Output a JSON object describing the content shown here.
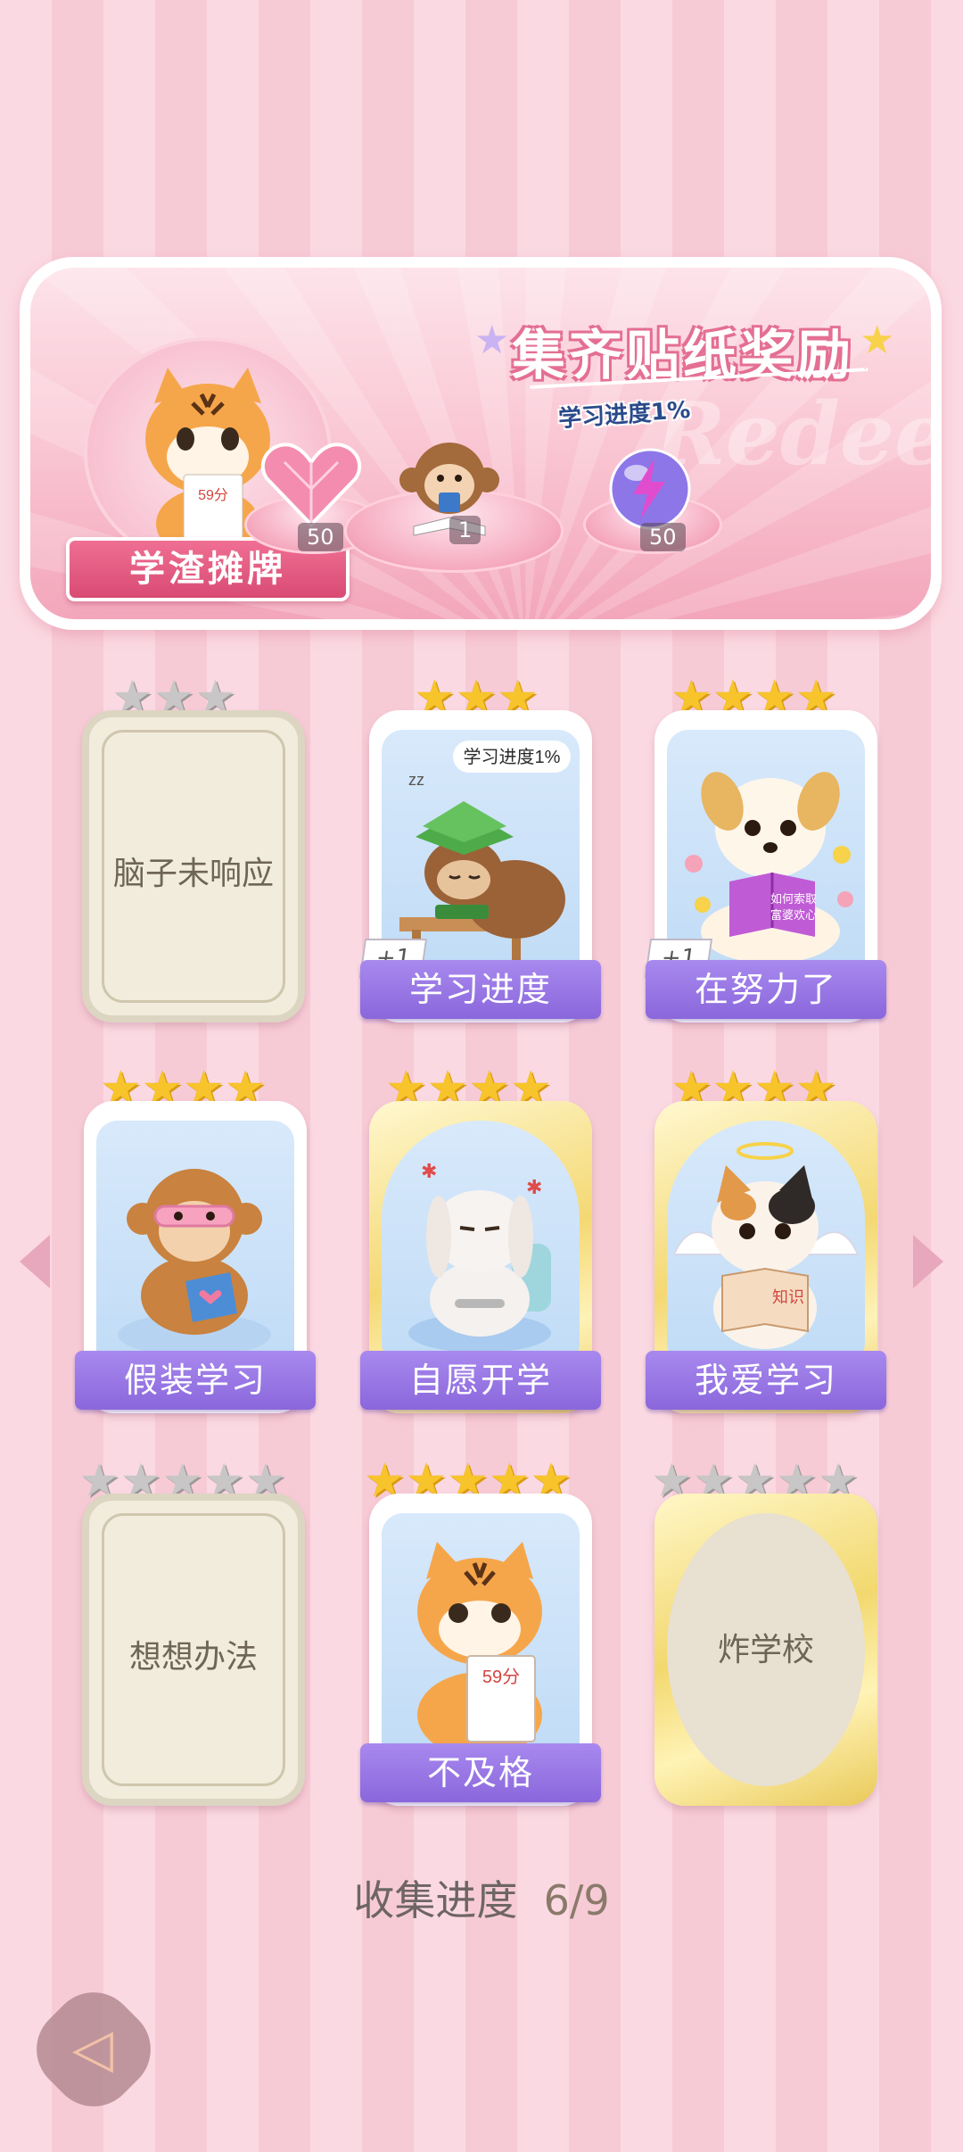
{
  "reward_banner": {
    "title": "集齐贴纸奖励",
    "avatar_badge": "学渣摊牌",
    "progress_tag": "学习进度1%",
    "watermark": "Redeem",
    "rewards": [
      {
        "name": "heart-gem-icon",
        "count": "50"
      },
      {
        "name": "monkey-sticker-icon",
        "count": "1"
      },
      {
        "name": "lightning-orb-icon",
        "count": "50"
      }
    ]
  },
  "stickers": [
    {
      "label": "脑子未响应",
      "stars_total": 3,
      "stars_earned": 0,
      "collected": false
    },
    {
      "label": "学习进度",
      "stars_total": 3,
      "stars_earned": 3,
      "collected": true,
      "bonus": "+1",
      "art_caption": "学习进度1%"
    },
    {
      "label": "在努力了",
      "stars_total": 4,
      "stars_earned": 4,
      "collected": true,
      "bonus": "+1",
      "art_caption": "如何索取富婆欢心"
    },
    {
      "label": "假装学习",
      "stars_total": 4,
      "stars_earned": 4,
      "collected": true
    },
    {
      "label": "自愿开学",
      "stars_total": 4,
      "stars_earned": 4,
      "collected": true
    },
    {
      "label": "我爱学习",
      "stars_total": 4,
      "stars_earned": 4,
      "collected": true,
      "art_caption": "知识"
    },
    {
      "label": "想想办法",
      "stars_total": 5,
      "stars_earned": 0,
      "collected": false
    },
    {
      "label": "不及格",
      "stars_total": 5,
      "stars_earned": 5,
      "collected": true,
      "art_caption": "59分"
    },
    {
      "label": "炸学校",
      "stars_total": 5,
      "stars_earned": 0,
      "collected": false
    }
  ],
  "collection_progress": {
    "label": "收集进度",
    "value": "6/9"
  },
  "colors": {
    "accent_pink": "#e46f93",
    "label_purple": "#8a67dc",
    "star_gold": "#f7c42c",
    "star_grey": "#c9c6c7"
  }
}
